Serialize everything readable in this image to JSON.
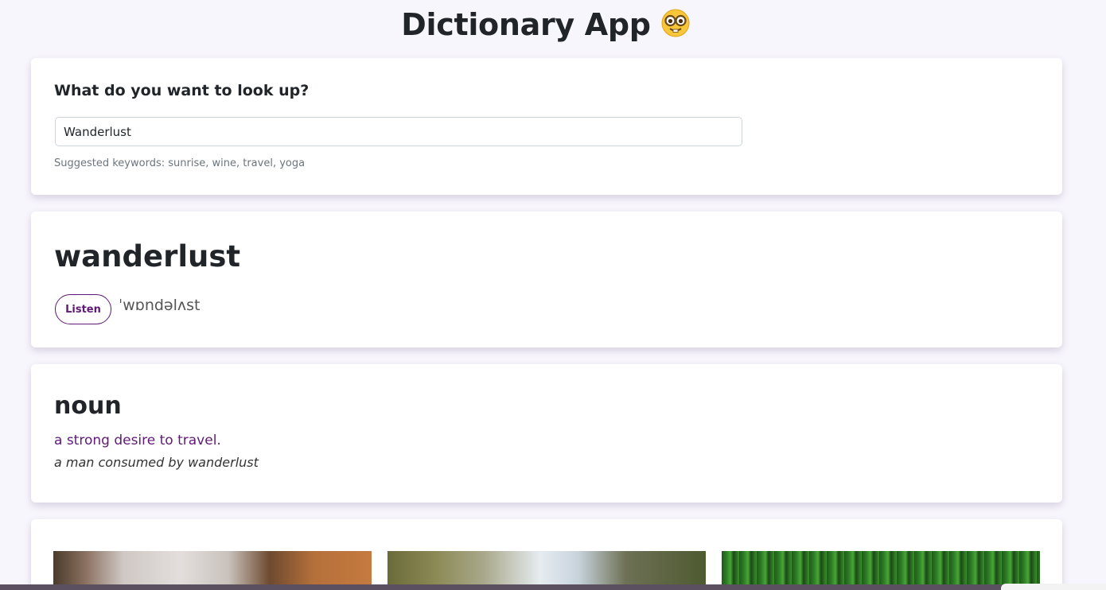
{
  "header": {
    "title": "Dictionary App",
    "emoji_icon": "nerd-face-icon"
  },
  "search": {
    "heading": "What do you want to look up?",
    "value": "Wanderlust",
    "hint": "Suggested keywords: sunrise, wine, travel, yoga"
  },
  "result": {
    "word": "wanderlust",
    "listen_label": "Listen",
    "phonetic": "ˈwɒndəlʌst"
  },
  "meaning": {
    "part_of_speech": "noun",
    "definition": "a strong desire to travel.",
    "example": "a man consumed by wanderlust"
  },
  "colors": {
    "accent": "#5f1a78",
    "background": "#f8f6fd"
  }
}
